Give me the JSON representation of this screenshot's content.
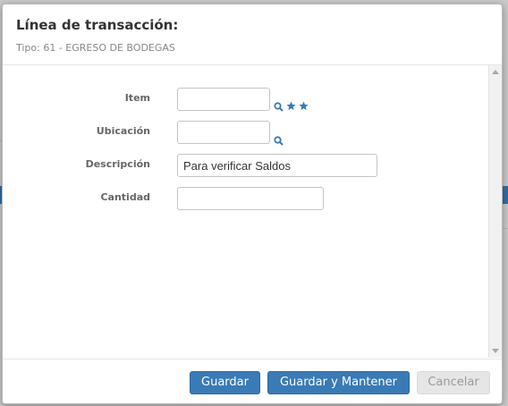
{
  "modal": {
    "title": "Línea de transacción:",
    "subtitle": "Tipo: 61 - EGRESO DE BODEGAS"
  },
  "form": {
    "item": {
      "label": "Item",
      "value": ""
    },
    "ubicacion": {
      "label": "Ubicación",
      "value": ""
    },
    "descripcion": {
      "label": "Descripción",
      "value": "Para verificar Saldos"
    },
    "cantidad": {
      "label": "Cantidad",
      "value": ""
    }
  },
  "icons": {
    "search": "search-icon",
    "star": "star-icon",
    "accent": "#3a7ab5"
  },
  "footer": {
    "save_label": "Guardar",
    "save_keep_label": "Guardar y Mantener",
    "cancel_label": "Cancelar"
  }
}
